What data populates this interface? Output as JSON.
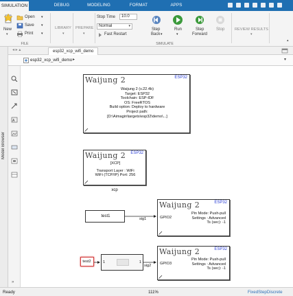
{
  "tabs": [
    {
      "label": "SIMULATION",
      "active": true
    },
    {
      "label": "DEBUG",
      "active": false
    },
    {
      "label": "MODELING",
      "active": false
    },
    {
      "label": "FORMAT",
      "active": false
    },
    {
      "label": "APPS",
      "active": false
    }
  ],
  "ribbon": {
    "new_label": "New",
    "open_label": "Open",
    "save_label": "Save",
    "print_label": "Print",
    "file_group": "FILE",
    "library_label": "LIBRARY",
    "prepare_label": "PREPARE",
    "stop_time_label": "Stop Time",
    "stop_time_value": "10.0",
    "sim_mode_value": "Normal",
    "fast_restart_label": "Fast Restart",
    "step_back_label_1": "Step",
    "step_back_label_2": "Back",
    "run_label": "Run",
    "step_forward_label_1": "Step",
    "step_forward_label_2": "Forward",
    "stop_label": "Stop",
    "simulate_group": "SIMULATE",
    "review_results_label": "REVIEW RESULTS"
  },
  "doc_tab": "esp32_xcp_wifi_demo",
  "breadcrumb": "esp32_xcp_wifi_demo",
  "model_browser_label": "Model Browser",
  "blocks": {
    "config": {
      "logo": "Waijung 2",
      "tag": "ESP32",
      "lines": [
        "Waijung 2 (v.22.4b)",
        "Target: ESP32",
        "Toolchain: ESP-IDF",
        "OS: FreeRTOS",
        "Build option: Deploy to hardware",
        "Project path:",
        "[D:\\Aimagin\\targets\\esp32\\demo\\...]"
      ]
    },
    "xcp": {
      "logo": "Waijung 2",
      "tag": "ESP32",
      "lines": [
        "[XCP]",
        "",
        "Transport Layer : WiFi",
        "WiFi (TCP/IP) Port: 256"
      ],
      "name": "xcp"
    },
    "gpio1": {
      "logo": "Waijung 2",
      "tag": "ESP32",
      "port_label": "GPIO2",
      "info": [
        "Pin Mode: Push-pull",
        "Settings : Advanced",
        "Ts (sec): -1"
      ]
    },
    "gpio2": {
      "logo": "Waijung 2",
      "tag": "ESP32",
      "port_label": "GPIO3",
      "info": [
        "Pin Mode: Push-pull",
        "Settings : Advanced",
        "Ts (sec): -1"
      ]
    },
    "test1": {
      "label": "test1",
      "signal": "sig1"
    },
    "test2": {
      "label": "test2",
      "signal": "sig2",
      "in_port": "1",
      "out_port": "1"
    }
  },
  "status": {
    "left": "Ready",
    "zoom": "111%",
    "solver": "FixedStepDiscrete"
  },
  "colors": {
    "tabbar": "#1f6fb2",
    "esp_tag": "#2b3fd6",
    "test2_highlight": "#d43b3b",
    "run_green": "#3c9a3c"
  }
}
